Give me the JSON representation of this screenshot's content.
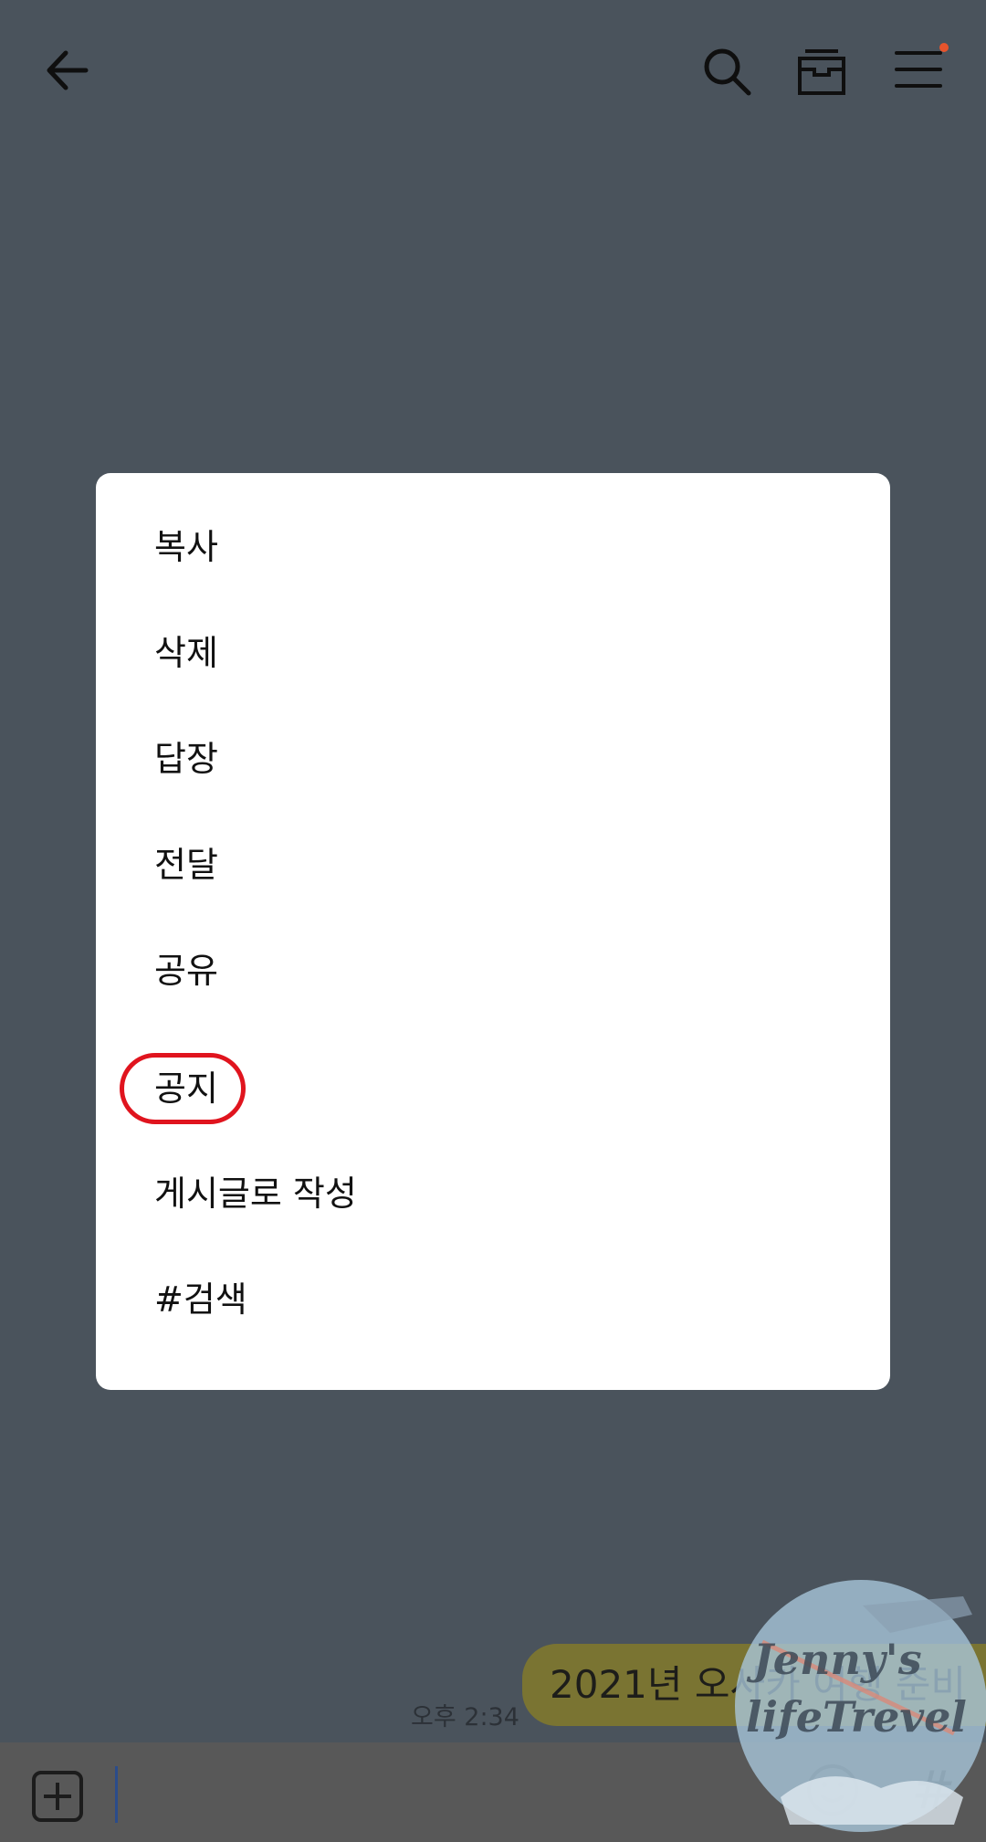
{
  "header": {
    "back_icon": "arrow-left-icon",
    "search_icon": "search-icon",
    "drawer_icon": "drawer-icon",
    "menu_icon": "hamburger-menu-icon",
    "notification_dot_color": "#e8542c"
  },
  "context_menu": {
    "items": [
      {
        "label": "복사"
      },
      {
        "label": "삭제"
      },
      {
        "label": "답장"
      },
      {
        "label": "전달"
      },
      {
        "label": "공유"
      },
      {
        "label": "공지",
        "highlighted": true
      },
      {
        "label": "게시글로 작성"
      },
      {
        "label": "#검색"
      }
    ],
    "highlight_color": "#e0141e"
  },
  "chat": {
    "message": "2021년 오사카 여행 준비",
    "time": "오후 2:34",
    "bubble_color": "#7a7432"
  },
  "input_bar": {
    "add_icon": "plus-box-icon",
    "emoji_icon": "smiley-icon",
    "hashtag_label": "#"
  },
  "watermark": {
    "line1": "Jenny's",
    "line2": "lifeTrevel"
  }
}
